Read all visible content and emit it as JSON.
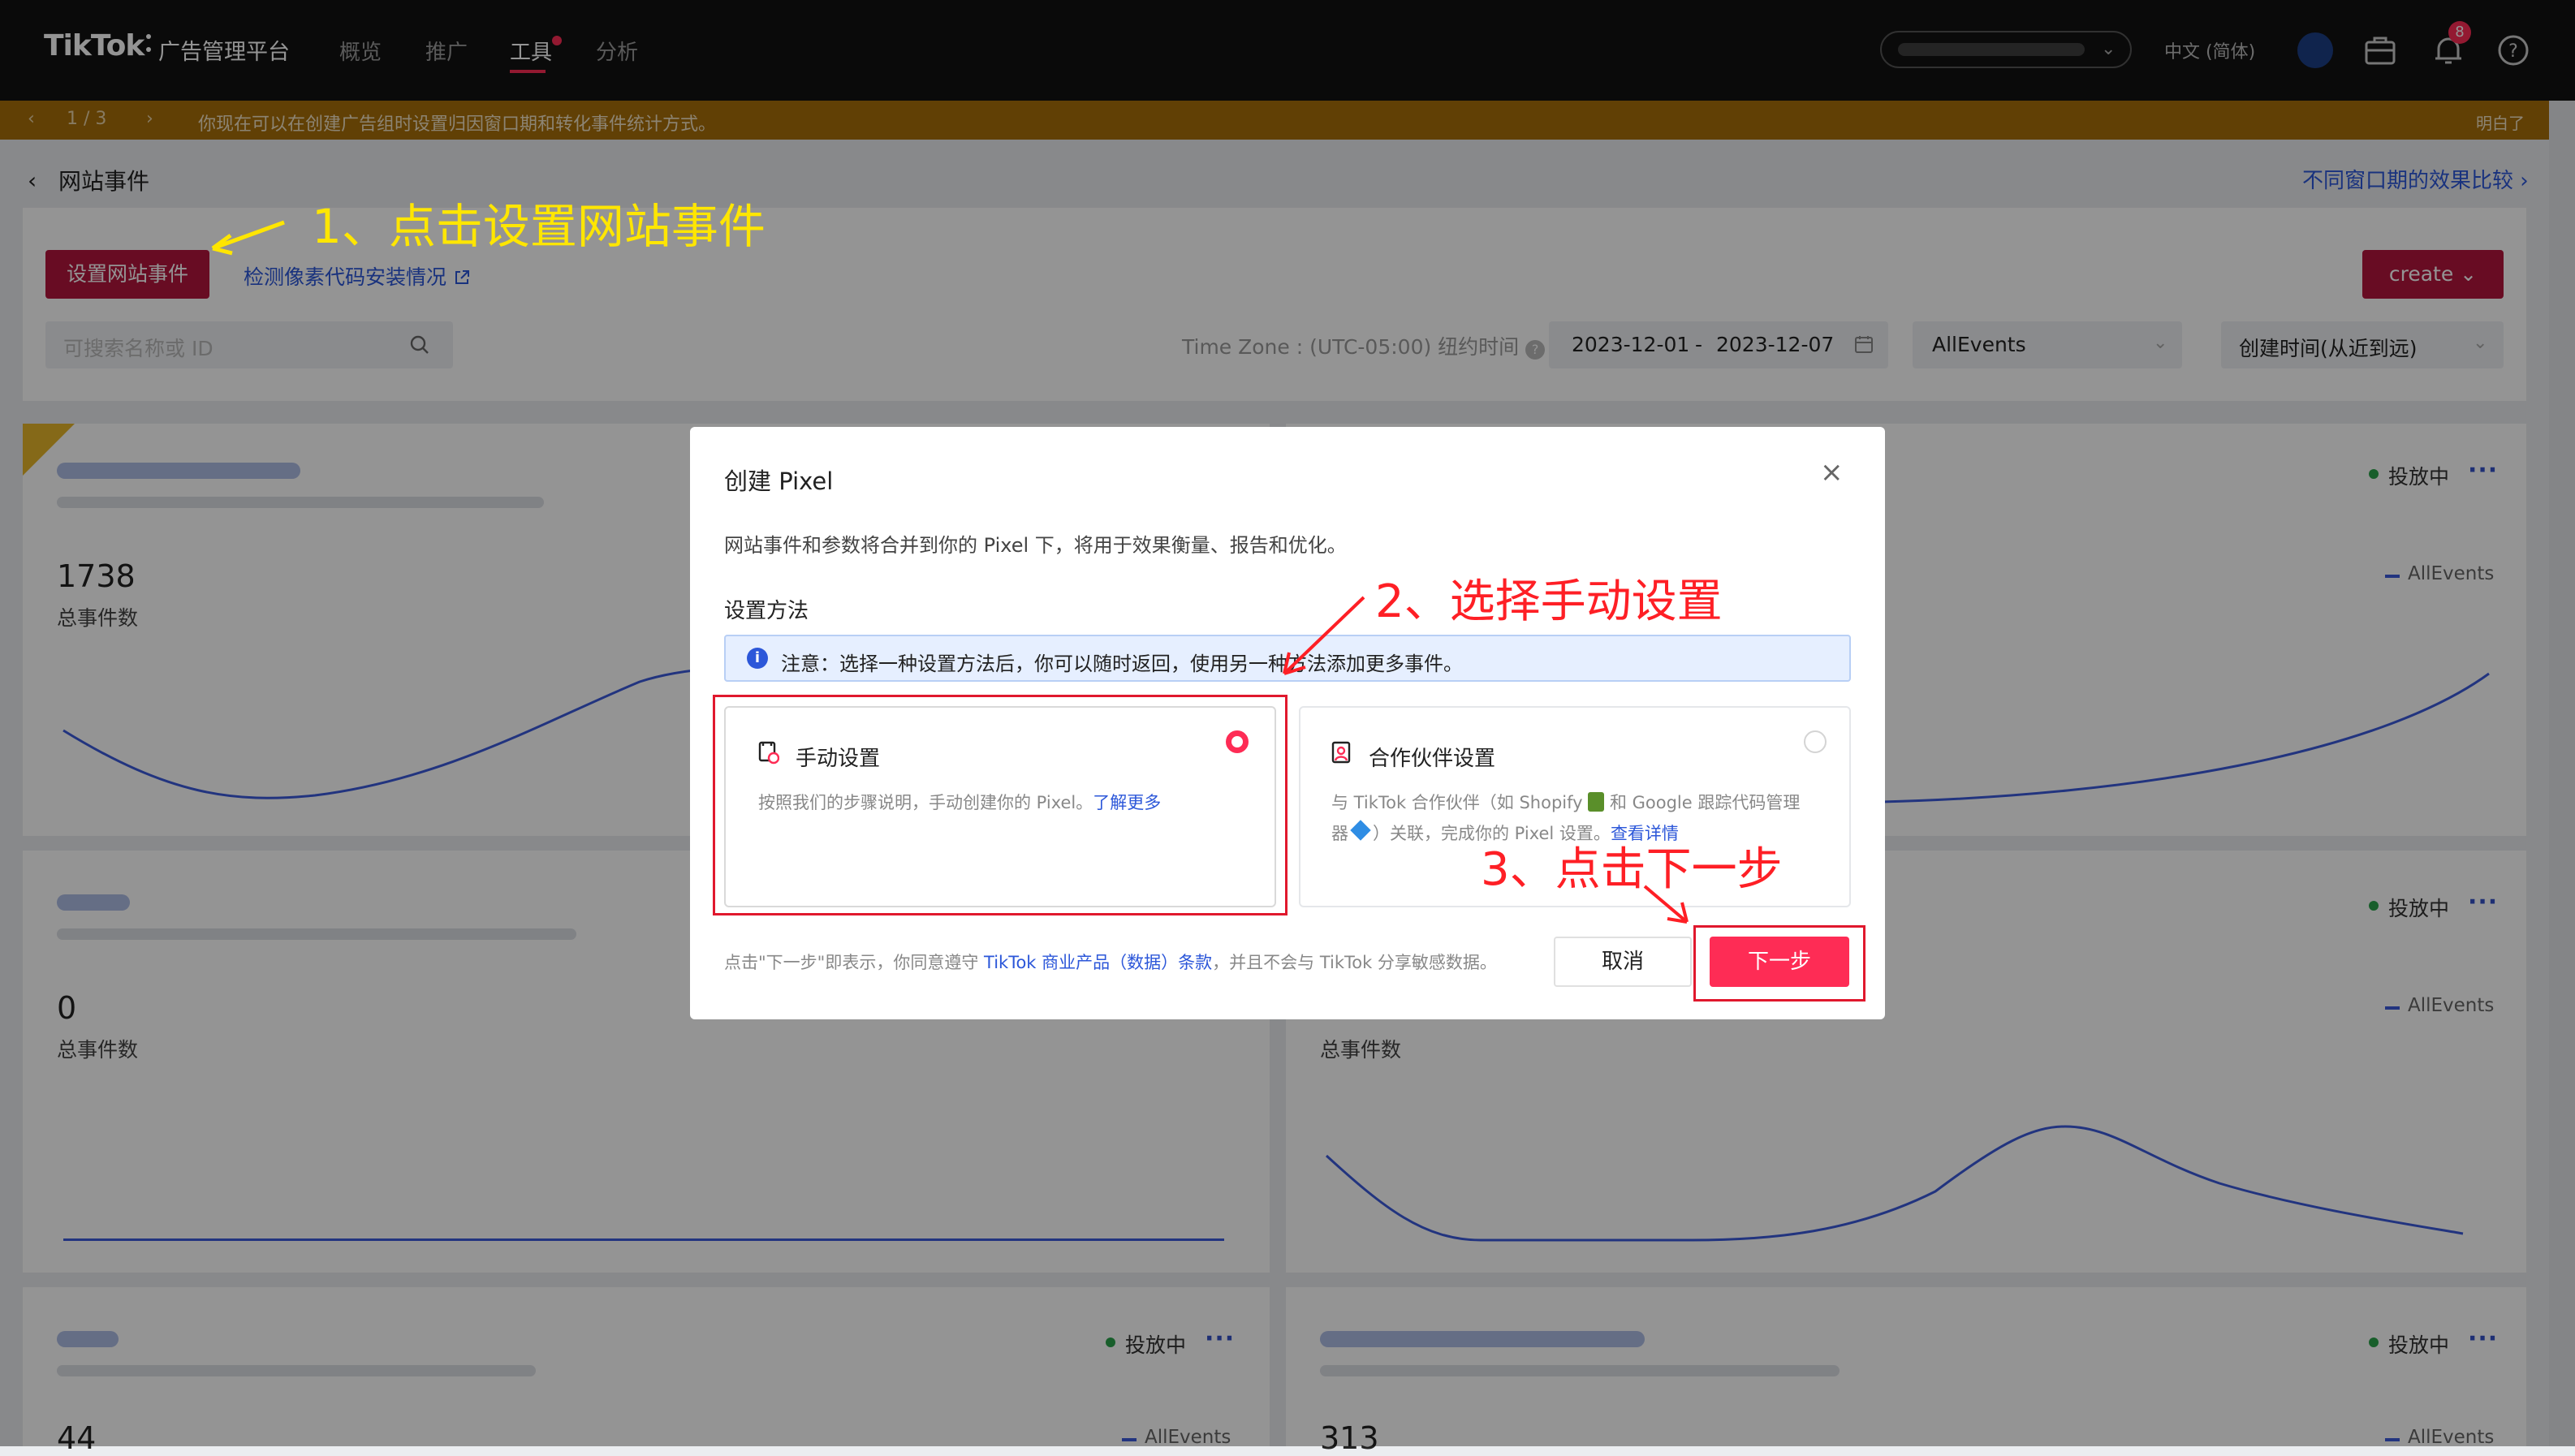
{
  "topbar": {
    "logo": "TikTok",
    "logo_sub": "广告管理平台",
    "nav": [
      "概览",
      "推广",
      "工具",
      "分析"
    ],
    "active_nav": "工具",
    "language": "中文 (简体)",
    "notification_count": "8"
  },
  "notice": {
    "pager": "1 / 3",
    "text": "你现在可以在创建广告组时设置归因窗口期和转化事件统计方式。",
    "dismiss": "明白了"
  },
  "header": {
    "title": "网站事件",
    "compare_link": "不同窗口期的效果比较"
  },
  "toolbar": {
    "setup_button": "设置网站事件",
    "check_link": "检测像素代码安装情况",
    "create_button": "create",
    "search_placeholder": "可搜索名称或 ID",
    "timezone": "Time Zone : (UTC-05:00) 纽约时间",
    "date_start": "2023-12-01",
    "date_sep": "-",
    "date_end": "2023-12-07",
    "event_filter": "AllEvents",
    "sort": "创建时间(从近到远)"
  },
  "cards": [
    {
      "total": "1738",
      "total_label": "总事件数",
      "status": "投放中",
      "legend": "AllEvents"
    },
    {
      "total": "0",
      "total_label": "总事件数",
      "status": "投放中",
      "legend": "AllEvents"
    },
    {
      "total_label": "总事件数"
    },
    {
      "total": "44",
      "status": "投放中",
      "legend": "AllEvents"
    },
    {
      "total": "313",
      "status": "投放中",
      "legend": "AllEvents"
    }
  ],
  "modal": {
    "title": "创建 Pixel",
    "description": "网站事件和参数将合并到你的 Pixel 下，将用于效果衡量、报告和优化。",
    "method_label": "设置方法",
    "alert": "注意：选择一种设置方法后，你可以随时返回，使用另一种方法添加更多事件。",
    "manual": {
      "title": "手动设置",
      "desc": "按照我们的步骤说明，手动创建你的 Pixel。",
      "link": "了解更多"
    },
    "partner": {
      "title": "合作伙伴设置",
      "desc1": "与 TikTok 合作伙伴（如 Shopify",
      "desc2": "和 Google 跟踪代码管理",
      "desc3": "器",
      "desc4": "）关联，完成你的 Pixel 设置。",
      "link": "查看详情"
    },
    "terms_prefix": "点击\"下一步\"即表示，你同意遵守",
    "terms_link": "TikTok 商业产品（数据）条款",
    "terms_suffix": "，并且不会与 TikTok 分享敏感数据。",
    "cancel": "取消",
    "next": "下一步"
  },
  "annotations": {
    "step1": "1、点击设置网站事件",
    "step2": "2、选择手动设置",
    "step3": "3、点击下一步"
  },
  "colors": {
    "brand": "#fe2c55",
    "setup_button": "#b4153d",
    "link": "#2c57d9",
    "chart_line": "#3b5bdb",
    "annotation_red": "#fe1f25",
    "annotation_yellow": "#ffe600",
    "notice_bar": "#a86e09"
  }
}
